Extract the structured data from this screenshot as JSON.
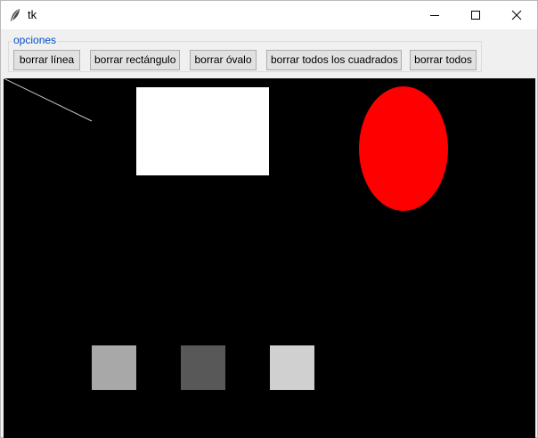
{
  "window": {
    "title": "tk",
    "icon": "feather-icon",
    "controls": {
      "minimize": "minimize-icon",
      "maximize": "maximize-icon",
      "close": "close-icon"
    }
  },
  "options_frame": {
    "label": "opciones",
    "buttons": [
      {
        "label": "borrar línea"
      },
      {
        "label": "borrar rectángulo"
      },
      {
        "label": "borrar óvalo"
      },
      {
        "label": "borrar todos los cuadrados"
      },
      {
        "label": "borrar todos"
      }
    ]
  },
  "canvas": {
    "background": "#000000",
    "line_color": "#c8c8c8",
    "rectangle_color": "#ffffff",
    "oval_color": "#ff0000",
    "squares": [
      {
        "color": "#a8a8a8"
      },
      {
        "color": "#585858"
      },
      {
        "color": "#d0d0d0"
      }
    ]
  }
}
